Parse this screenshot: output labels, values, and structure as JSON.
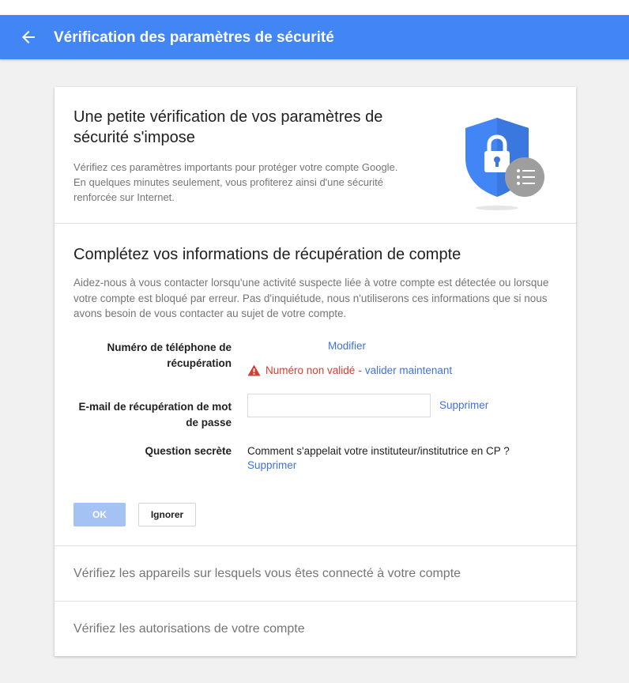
{
  "header": {
    "title": "Vérification des paramètres de sécurité",
    "back_icon": "arrow-left-icon",
    "color": "#4285f4"
  },
  "intro": {
    "title": "Une petite vérification de vos paramètres de sécurité s'impose",
    "description": "Vérifiez ces paramètres importants pour protéger votre compte Google. En quelques minutes seulement, vous profiterez ainsi d'une sécurité renforcée sur Internet.",
    "illustration_icon": "security-shield-icon"
  },
  "recovery": {
    "title": "Complétez vos informations de récupération de compte",
    "description": "Aidez-nous à vous contacter lorsqu'une activité suspecte liée à votre compte est détectée ou lorsque votre compte est bloqué par erreur. Pas d'inquiétude, nous n'utiliserons ces informations que si nous avons besoin de vous contacter au sujet de votre compte.",
    "phone": {
      "label": "Numéro de téléphone de récupération",
      "modify_label": "Modifier",
      "warning_text": "Numéro non validé",
      "separator": "-",
      "validate_label": "valider maintenant",
      "warning_color": "#d23f31"
    },
    "email": {
      "label": "E-mail de récupération de mot de passe",
      "value": "",
      "delete_label": "Supprimer"
    },
    "question": {
      "label": "Question secrète",
      "value": "Comment s'appelait votre instituteur/institutrice en CP ?",
      "delete_label": "Supprimer"
    },
    "buttons": {
      "ok_label": "OK",
      "ignore_label": "Ignorer"
    }
  },
  "sections": {
    "devices_label": "Vérifiez les appareils sur lesquels vous êtes connecté à votre compte",
    "permissions_label": "Vérifiez les autorisations de votre compte"
  }
}
